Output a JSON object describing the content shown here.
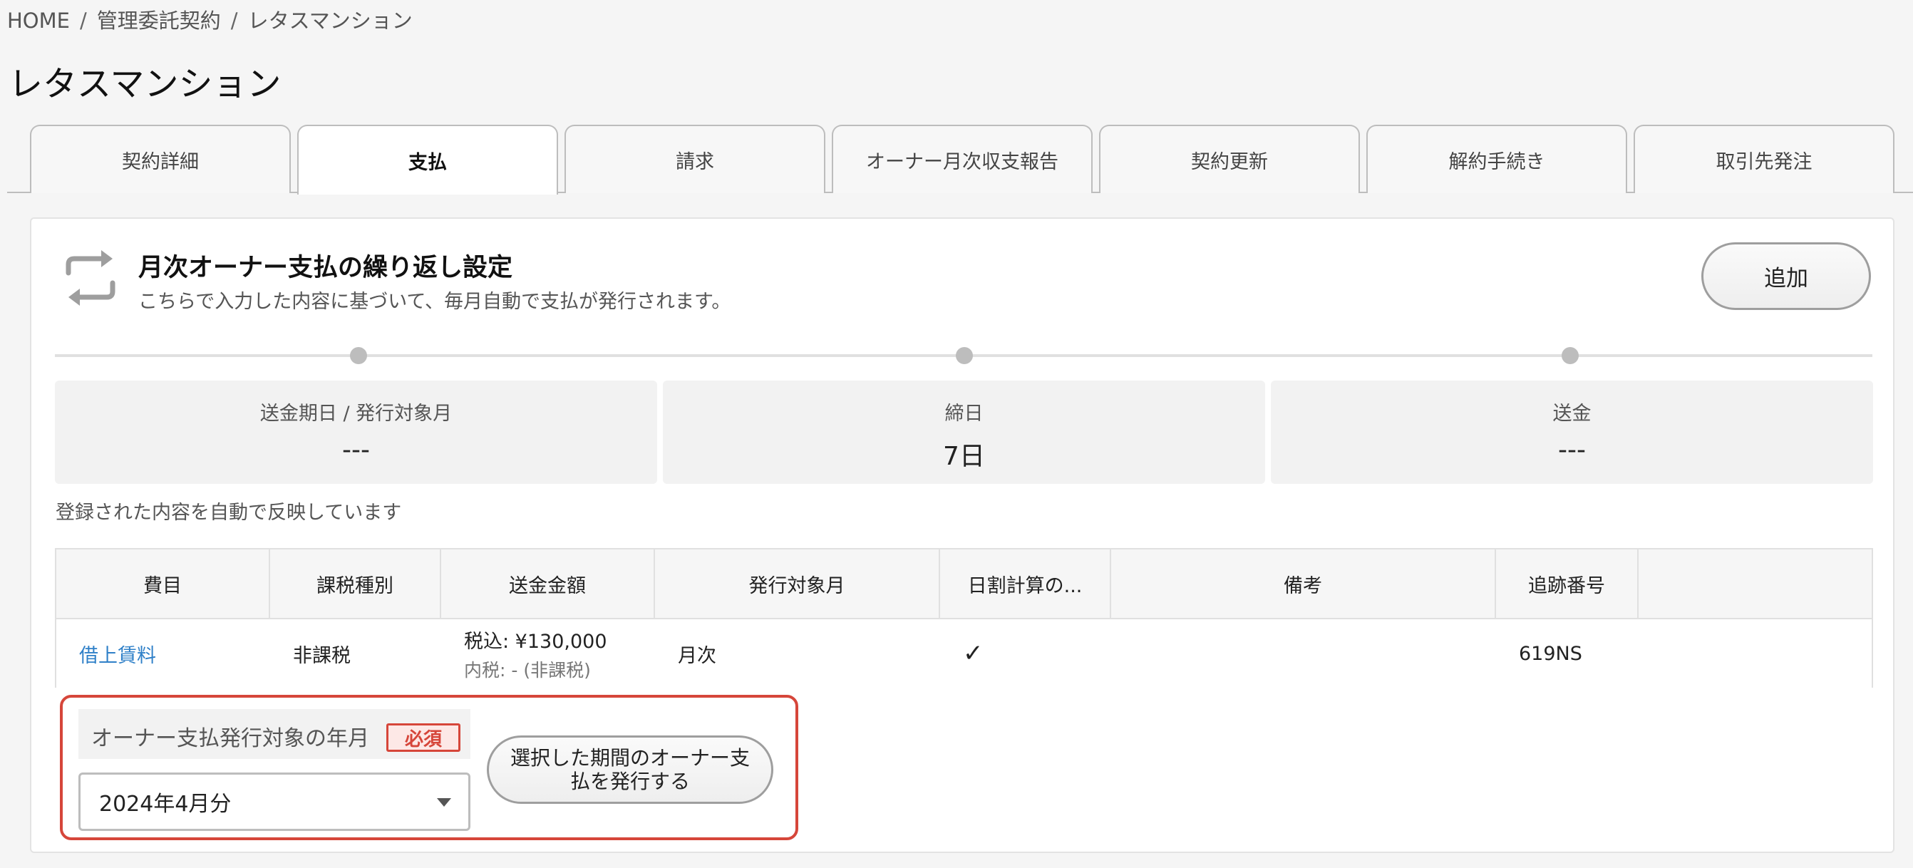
{
  "breadcrumb": [
    "HOME",
    "管理委託契約",
    "レタスマンション"
  ],
  "page_title": "レタスマンション",
  "tabs": [
    {
      "label": "契約詳細",
      "active": false
    },
    {
      "label": "支払",
      "active": true
    },
    {
      "label": "請求",
      "active": false
    },
    {
      "label": "オーナー月次収支報告",
      "active": false
    },
    {
      "label": "契約更新",
      "active": false
    },
    {
      "label": "解約手続き",
      "active": false
    },
    {
      "label": "取引先発注",
      "active": false
    }
  ],
  "panel": {
    "title": "月次オーナー支払の繰り返し設定",
    "subtitle": "こちらで入力した内容に基づいて、毎月自動で支払が発行されます。",
    "add_label": "追加",
    "icon": "repeat-icon"
  },
  "summary": [
    {
      "label": "送金期日 / 発行対象月",
      "value": "---"
    },
    {
      "label": "締日",
      "value": "7日"
    },
    {
      "label": "送金",
      "value": "---"
    }
  ],
  "auto_note": "登録された内容を自動で反映しています",
  "table": {
    "headers": [
      "費目",
      "課税種別",
      "送金金額",
      "発行対象月",
      "日割計算の...",
      "備考",
      "追跡番号",
      ""
    ],
    "rows": [
      {
        "item": "借上賃料",
        "tax_type": "非課税",
        "amount_main": "税込: ¥130,000",
        "amount_sub": "内税: - (非課税)",
        "target_month": "月次",
        "prorated": "✓",
        "note": "",
        "tracking": "619NS"
      }
    ]
  },
  "issue": {
    "label": "オーナー支払発行対象の年月",
    "required": "必須",
    "selected_month": "2024年4月分",
    "button_label": "選択した期間のオーナー支払を発行する"
  },
  "colors": {
    "link": "#2f80c8",
    "required": "#d6463a"
  }
}
